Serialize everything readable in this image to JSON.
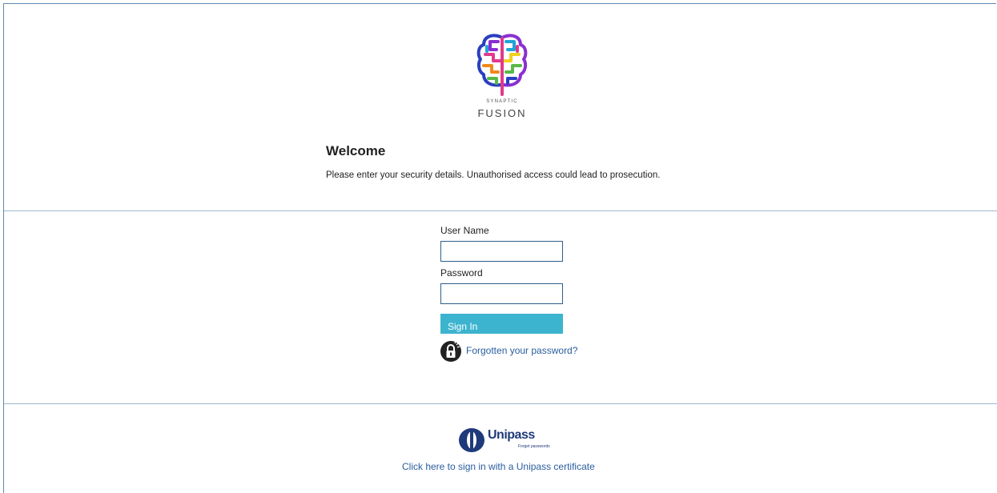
{
  "brand": {
    "tagline": "SYNAPTIC",
    "name": "FUSION",
    "logo_icon": "brain-icon"
  },
  "intro": {
    "title": "Welcome",
    "notice": "Please enter your security details. Unauthorised access could lead to prosecution."
  },
  "login": {
    "username_label": "User Name",
    "username_value": "",
    "password_label": "Password",
    "password_value": "",
    "signin_label": "Sign In",
    "forgot_label": "Forgotten your password?",
    "forgot_icon": "lock-icon"
  },
  "unipass": {
    "name": "Unipass",
    "tag": "Forget passwords",
    "link_label": "Click here to sign in with a Unipass certificate"
  },
  "colors": {
    "accent": "#3db4cf",
    "link": "#2a5d9f",
    "border": "#2e5f8a",
    "divider": "#9bb7cf"
  }
}
